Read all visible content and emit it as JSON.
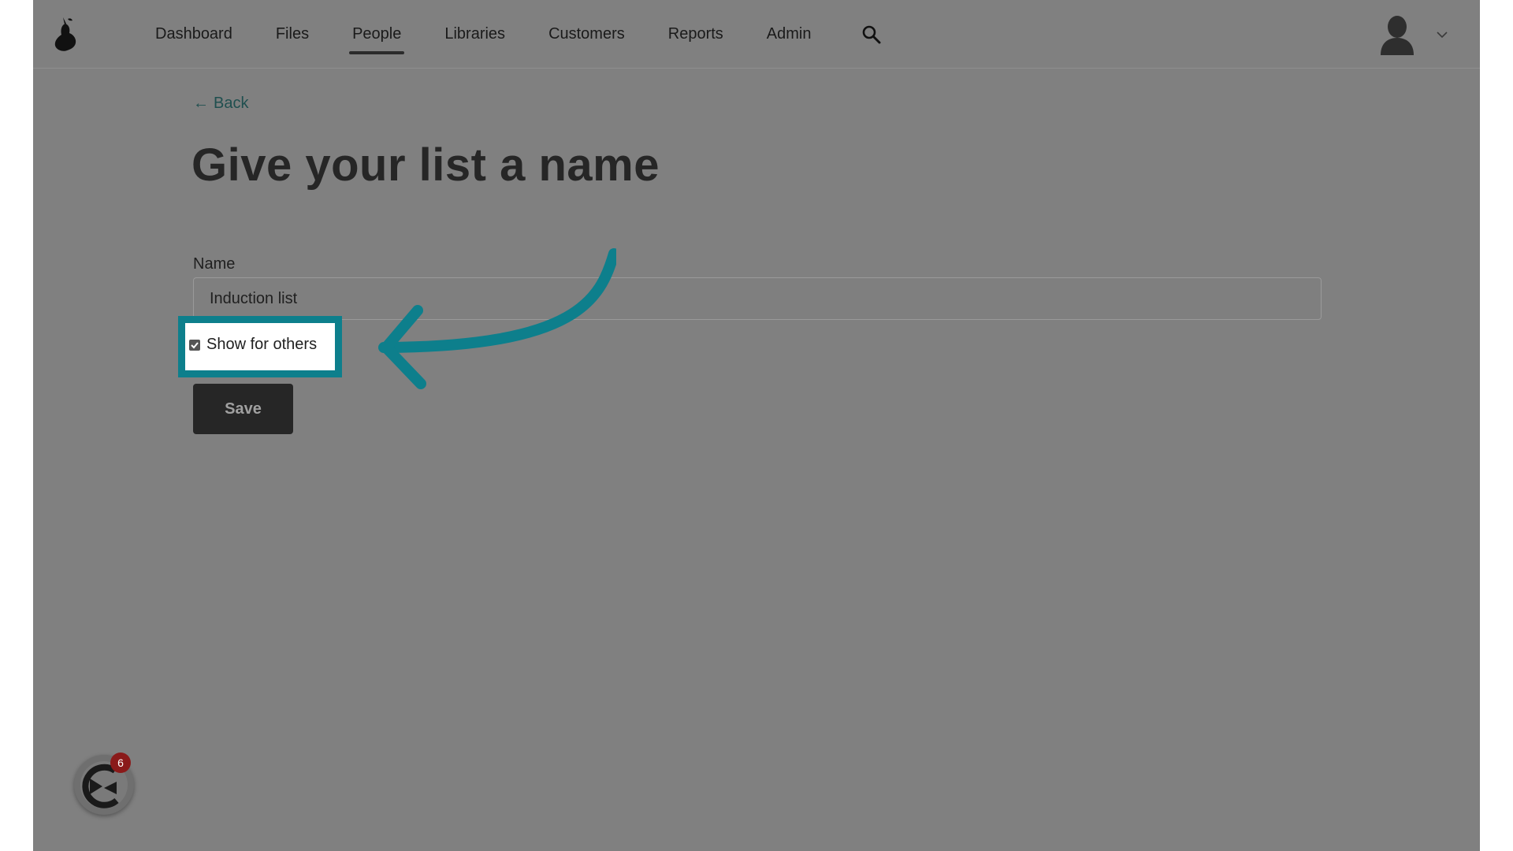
{
  "nav": {
    "logo_icon": "pear-logo-icon",
    "items": [
      {
        "label": "Dashboard",
        "active": false
      },
      {
        "label": "Files",
        "active": false
      },
      {
        "label": "People",
        "active": true
      },
      {
        "label": "Libraries",
        "active": false
      },
      {
        "label": "Customers",
        "active": false
      },
      {
        "label": "Reports",
        "active": false
      },
      {
        "label": "Admin",
        "active": false
      }
    ],
    "search_icon": "search-icon",
    "avatar_icon": "avatar-icon",
    "chevron_icon": "chevron-down-icon"
  },
  "back": {
    "arrow": "←",
    "label": "Back"
  },
  "page": {
    "title": "Give your list a name"
  },
  "form": {
    "name_label": "Name",
    "name_value": "Induction list",
    "checkbox_label": "Show for others",
    "checkbox_checked": true,
    "save_label": "Save"
  },
  "widget": {
    "icon": "chat-widget-icon",
    "badge_count": "6"
  },
  "colors": {
    "overlay": "#808080",
    "accent": "#0d7f8c",
    "button": "#262626",
    "badge": "#8a1a1a"
  }
}
